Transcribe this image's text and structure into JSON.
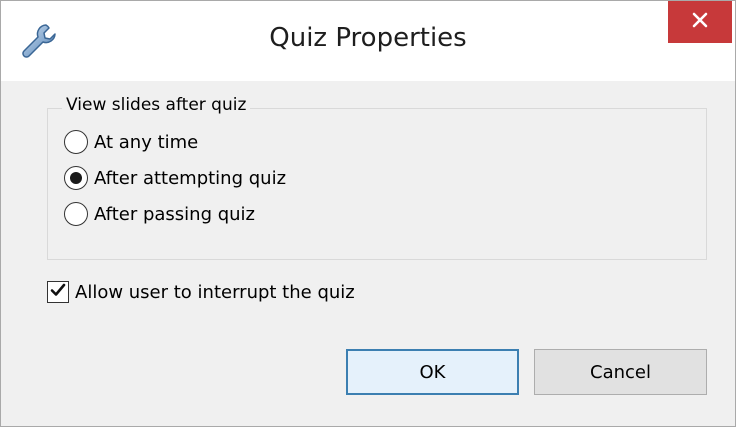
{
  "window": {
    "title": "Quiz Properties",
    "title_icon": "wrench-icon",
    "close_icon": "close-icon",
    "close_color": "#c7393a"
  },
  "group": {
    "legend": "View slides after quiz",
    "options": [
      {
        "label": "At any time",
        "selected": false
      },
      {
        "label": "After attempting quiz",
        "selected": true
      },
      {
        "label": "After passing quiz",
        "selected": false
      }
    ]
  },
  "checkbox": {
    "label": "Allow user to interrupt the quiz",
    "checked": true
  },
  "buttons": {
    "ok_label": "OK",
    "cancel_label": "Cancel"
  }
}
